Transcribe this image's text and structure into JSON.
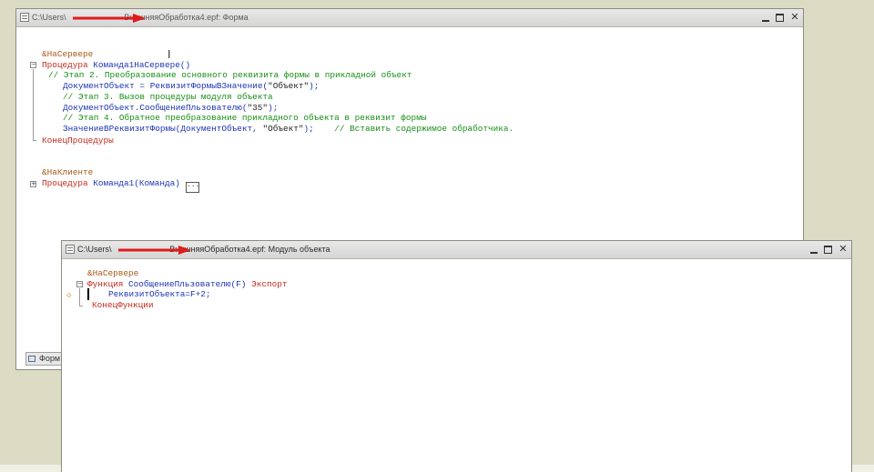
{
  "back_window": {
    "title": "C:\\Users\\███████\\Downloads\\ВнешняяОбработка4.epf: Форма",
    "title_visible_prefix": "C:\\Users\\",
    "title_visible_suffix": "ВнешняяОбработка4.epf: Форма",
    "tab_label": "Форм",
    "code": {
      "l1": "&НаСервере",
      "l2_kw": "Процедура",
      "l2_name": "Команда1НаСервере()",
      "l3": "// Этап 2. Преобразование основного реквизита формы в прикладной объект",
      "l4_a": "ДокументОбъект",
      "l4_b": "=",
      "l4_c": "РеквизитФормыВЗначение",
      "l4_d": "(",
      "l4_e": "\"Объект\"",
      "l4_f": ");",
      "l5": "// Этап 3. Вызов процедуры модуля объекта",
      "l6_a": "ДокументОбъект.СообщениеПльзователю(",
      "l6_b": "\"35\"",
      "l6_c": ");",
      "l7": "// Этап 4. Обратное преобразование прикладного объекта в реквизит формы",
      "l8_a": "ЗначениеВРеквизитФормы(ДокументОбъект,",
      "l8_b": "\"Объект\"",
      "l8_c": ");",
      "l8_d": "// Вставить содержимое обработчика.",
      "l9": "КонецПроцедуры",
      "l10": "&НаКлиенте",
      "l11_kw": "Процедура",
      "l11_name": "Команда1(Команда)",
      "l11_box": "..."
    }
  },
  "front_window": {
    "title": "C:\\Users\\███████\\Downloads\\ВнешняяОбработка4.epf: Модуль объекта",
    "title_visible_prefix": "C:\\Users\\",
    "title_visible_suffix": "ВнешняяОбработка4.epf: Модуль объекта",
    "code": {
      "l1": "&НаСервере",
      "l2_kw": "Функция",
      "l2_name": "СообщениеПльзователю(F)",
      "l2_export": "Экспорт",
      "l3": "РеквизитОбъекта=F+2;",
      "l4": "КонецФункции"
    }
  },
  "window_buttons": {
    "minimize": "minimize",
    "maximize": "maximize",
    "close": "✕"
  },
  "colors": {
    "keyword": "#c22a1e",
    "identifier": "#1d35b4",
    "comment": "#178f17",
    "arrow": "#e01b1b"
  }
}
